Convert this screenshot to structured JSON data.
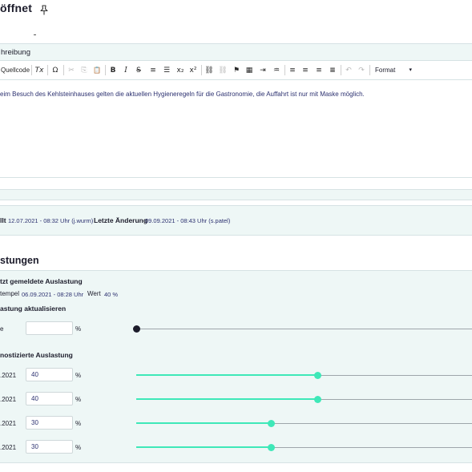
{
  "header": {
    "title": "öffnet",
    "pin_icon": "pin-icon"
  },
  "editor": {
    "label": "hreibung",
    "toolbar": {
      "source_label": "Quellcode",
      "clear_format": "Tx",
      "omega": "Ω",
      "cut": "✂",
      "copy": "⎘",
      "paste": "📋",
      "bold": "B",
      "italic": "I",
      "strike": "S",
      "ordered_list": "≡",
      "bullet_list": "☰",
      "subscript": "x₂",
      "superscript": "x²",
      "link": "⛓",
      "unlink": "⛓",
      "anchor": "⚑",
      "table": "▦",
      "indent": "⇥",
      "special": "♒",
      "align_left": "≡",
      "align_center": "≡",
      "align_right": "≡",
      "justify": "≡",
      "undo": "↶",
      "redo": "↷",
      "format_label": "Format",
      "format_caret": "▾"
    },
    "content": "eim Besuch des Kehlsteinhauses gelten die aktuellen Hygieneregeln für die Gastronomie, die Auffahrt ist nur mit Maske möglich."
  },
  "meta": {
    "created_label": "llt",
    "created_value": "12.07.2021 - 08:32 Uhr (j.wurm)",
    "changed_label": "Letzte Änderung",
    "changed_value": "09.09.2021 - 08:43 Uhr (s.patel)"
  },
  "section": {
    "title": "stungen"
  },
  "load": {
    "reported_heading": "tzt gemeldete Auslastung",
    "timestamp_label": "tempel",
    "timestamp_value": "06.09.2021 - 08:28 Uhr",
    "value_label": "Wert",
    "value_value": "40 %",
    "update_heading": "astung aktualisieren",
    "update_row": {
      "label": "e",
      "value": "",
      "pct": "%",
      "level": 0
    },
    "forecast_heading": "nostizierte Auslastung",
    "forecast_rows": [
      {
        "label": ".2021",
        "value": "40",
        "pct": "%",
        "level": 0.54
      },
      {
        "label": ".2021",
        "value": "40",
        "pct": "%",
        "level": 0.54
      },
      {
        "label": ".2021",
        "value": "30",
        "pct": "%",
        "level": 0.4
      },
      {
        "label": ".2021",
        "value": "30",
        "pct": "%",
        "level": 0.4
      }
    ]
  },
  "colors": {
    "accent": "#3ee8b8",
    "panel_bg": "#eef7f6",
    "text_dark": "#1c1c2b",
    "text_value": "#2c3170"
  }
}
